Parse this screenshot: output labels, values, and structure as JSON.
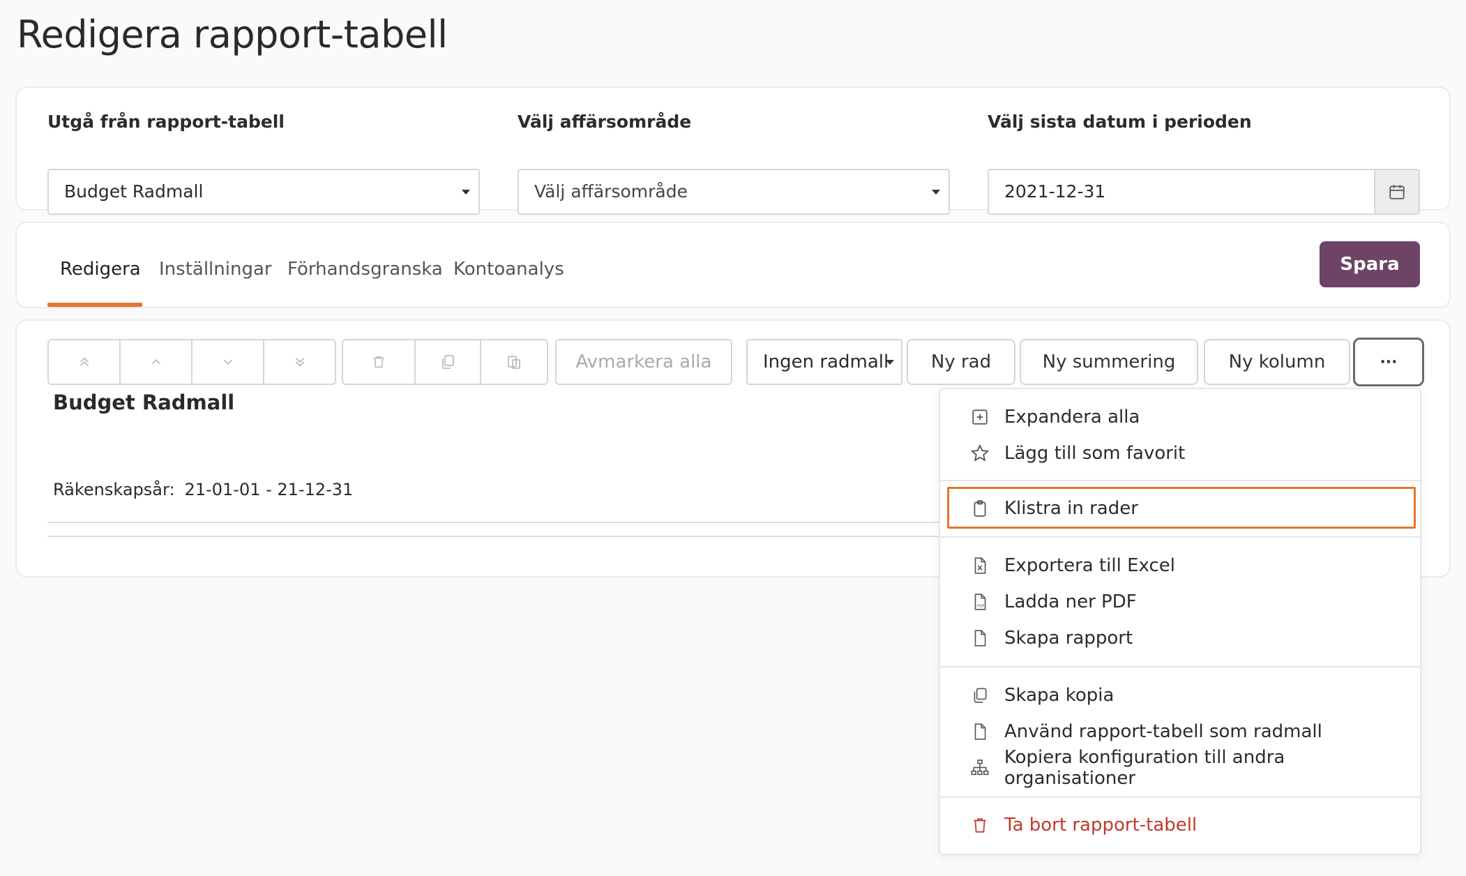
{
  "page": {
    "title": "Redigera rapport-tabell"
  },
  "filters": {
    "report_table": {
      "label": "Utgå från rapport-tabell",
      "value": "Budget Radmall"
    },
    "business_area": {
      "label": "Välj affärsområde",
      "value": "Välj affärsområde"
    },
    "period_end": {
      "label": "Välj sista datum i perioden",
      "value": "2021-12-31"
    }
  },
  "tabs": [
    {
      "label": "Redigera",
      "active": true
    },
    {
      "label": "Inställningar"
    },
    {
      "label": "Förhandsgranska"
    },
    {
      "label": "Kontoanalys"
    }
  ],
  "save_label": "Spara",
  "toolbar": {
    "deselect_all": "Avmarkera alla",
    "template_select": "Ingen radmall",
    "new_row": "Ny rad",
    "new_sum": "Ny summering",
    "new_column": "Ny kolumn",
    "more": "···"
  },
  "report": {
    "title": "Budget Radmall",
    "fiscal_year_label": "Räkenskapsår:",
    "fiscal_year_value": "21-01-01 - 21-12-31"
  },
  "menu": {
    "items": [
      {
        "label": "Expandera alla",
        "icon": "plus-square-icon"
      },
      {
        "label": "Lägg till som favorit",
        "icon": "star-icon"
      },
      {
        "label": "Klistra in rader",
        "icon": "clipboard-icon",
        "highlighted": true
      },
      {
        "label": "Exportera till Excel",
        "icon": "excel-file-icon"
      },
      {
        "label": "Ladda ner PDF",
        "icon": "pdf-file-icon"
      },
      {
        "label": "Skapa rapport",
        "icon": "file-icon"
      },
      {
        "label": "Skapa kopia",
        "icon": "copy-icon"
      },
      {
        "label": "Använd rapport-tabell som radmall",
        "icon": "file-icon"
      },
      {
        "label": "Kopiera konfiguration till andra organisationer",
        "icon": "org-tree-icon"
      },
      {
        "label": "Ta bort rapport-tabell",
        "icon": "trash-icon",
        "danger": true
      }
    ]
  },
  "colors": {
    "accent": "#e8742f",
    "primary_button": "#6e4466",
    "danger": "#c0392b"
  }
}
